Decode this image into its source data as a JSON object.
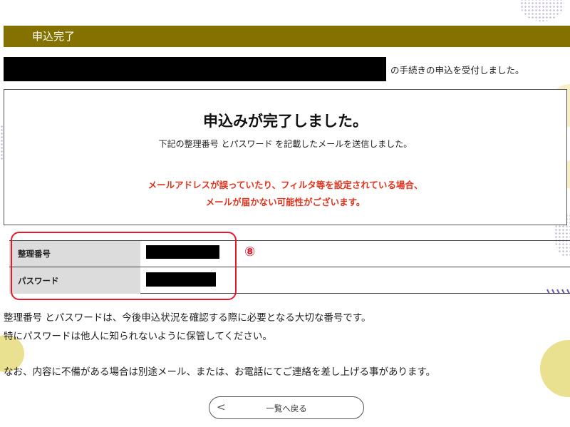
{
  "header": {
    "title": "申込完了"
  },
  "accept_message": "の手続きの申込を受付しました。",
  "message_box": {
    "title": "申込みが完了しました。",
    "subtitle": "下記の整理番号 とパスワード を記載したメールを送信しました。",
    "warning_line1": "メールアドレスが誤っていたり、フィルタ等を設定されている場合、",
    "warning_line2": "メールが届かない可能性がございます。"
  },
  "info_table": {
    "rows": [
      {
        "label": "整理番号"
      },
      {
        "label": "パスワード"
      }
    ]
  },
  "annotation": {
    "label": "⑧",
    "color": "#e8182c"
  },
  "notes": {
    "line1": "整理番号 とパスワードは、今後申込状況を確認する際に必要となる大切な番号です。",
    "line2": "特にパスワードは他人に知られないように保管してください。",
    "line3": "なお、内容に不備がある場合は別途メール、または、お電話にてご連絡を差し上げる事があります。"
  },
  "back_button": {
    "chevron": "<",
    "label": "一覧へ戻る"
  },
  "colors": {
    "header_bg": "#857100",
    "warning_text": "#e0341e",
    "label_bg": "#dcdcdc"
  }
}
